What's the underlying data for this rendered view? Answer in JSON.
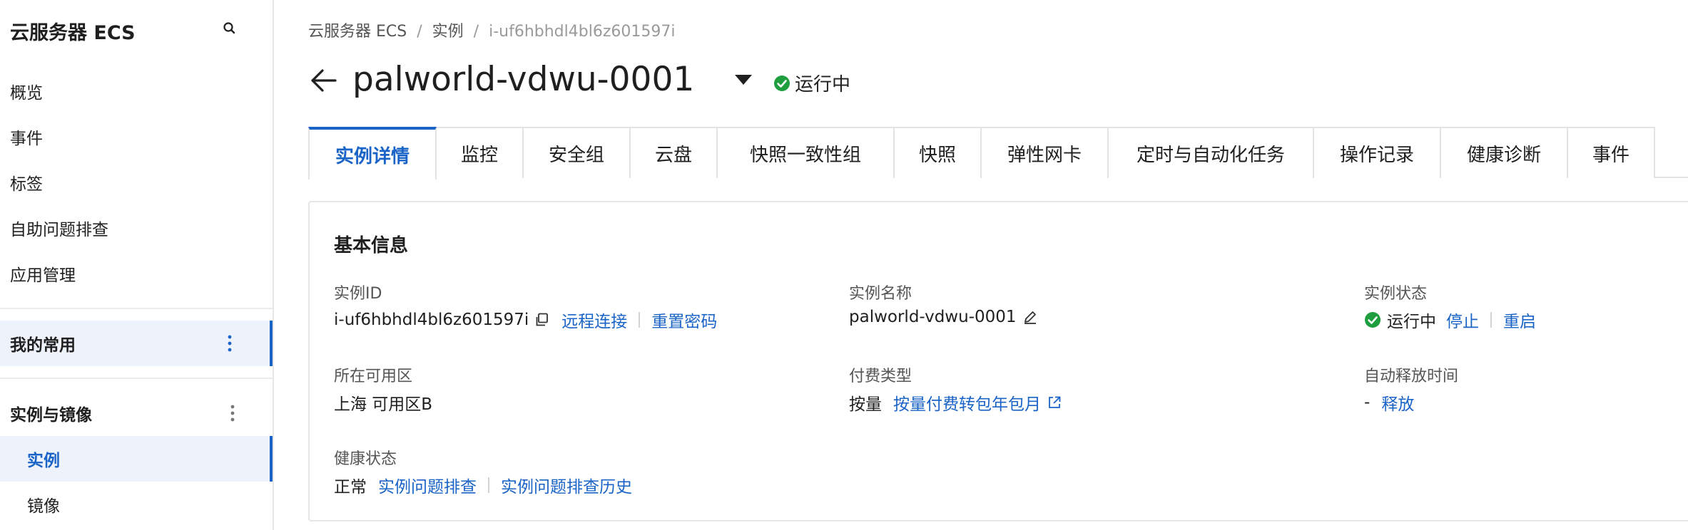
{
  "sidebar": {
    "title": "云服务器 ECS",
    "nav_items": [
      "概览",
      "事件",
      "标签",
      "自助问题排查",
      "应用管理"
    ],
    "group_common": "我的常用",
    "group_instances": "实例与镜像",
    "sub_items": [
      "实例",
      "镜像"
    ]
  },
  "breadcrumb": {
    "root": "云服务器 ECS",
    "section": "实例",
    "current": "i-uf6hbhdl4bl6z601597i",
    "separator": "/"
  },
  "header": {
    "title": "palworld-vdwu-0001",
    "status": "运行中"
  },
  "tabs": [
    "实例详情",
    "监控",
    "安全组",
    "云盘",
    "快照一致性组",
    "快照",
    "弹性网卡",
    "定时与自动化任务",
    "操作记录",
    "健康诊断",
    "事件"
  ],
  "basic_info": {
    "title": "基本信息",
    "instance_id": {
      "label": "实例ID",
      "value": "i-uf6hbhdl4bl6z601597i",
      "action_remote": "远程连接",
      "action_reset": "重置密码"
    },
    "instance_name": {
      "label": "实例名称",
      "value": "palworld-vdwu-0001"
    },
    "instance_status": {
      "label": "实例状态",
      "value": "运行中",
      "action_stop": "停止",
      "action_restart": "重启"
    },
    "zone": {
      "label": "所在可用区",
      "value": "上海 可用区B"
    },
    "billing": {
      "label": "付费类型",
      "value": "按量",
      "action_convert": "按量付费转包年包月"
    },
    "auto_release": {
      "label": "自动释放时间",
      "value": "-",
      "action_release": "释放"
    },
    "health": {
      "label": "健康状态",
      "value": "正常",
      "action_troubleshoot": "实例问题排查",
      "action_history": "实例问题排查历史"
    }
  },
  "colors": {
    "accent": "#1a63c7",
    "status_green": "#1e9e3e",
    "active_bg": "#eef3fb"
  }
}
